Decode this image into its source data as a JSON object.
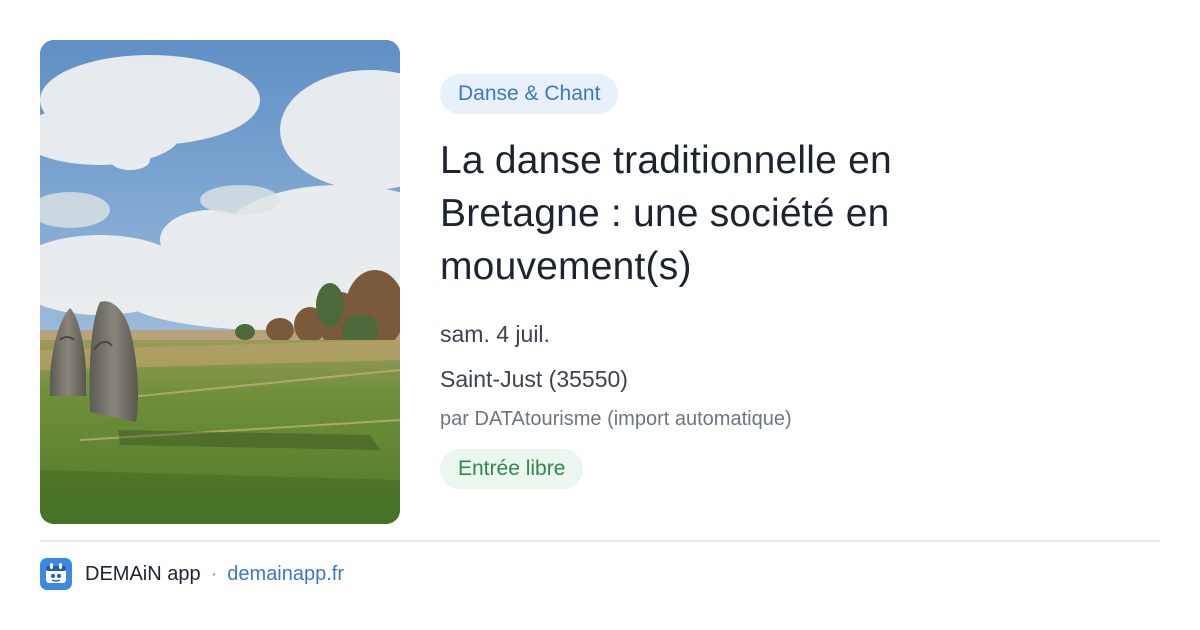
{
  "event": {
    "category": "Danse & Chant",
    "title": "La danse traditionnelle en Bretagne : une société en mouvement(s)",
    "date": "sam. 4 juil.",
    "location": "Saint-Just (35550)",
    "source": "par DATAtourisme (import automatique)",
    "price": "Entrée libre",
    "image_icon": "standing-stones-photo"
  },
  "footer": {
    "app_name": "DEMAiN app",
    "separator": "·",
    "url": "demainapp.fr",
    "icon": "demain-app-icon"
  },
  "colors": {
    "category_bg": "#e8f0fb",
    "category_text": "#3a78c9",
    "price_bg": "#eaf6ee",
    "price_text": "#2f8a4b",
    "title_text": "#1c2433",
    "link": "#3a78c9"
  }
}
